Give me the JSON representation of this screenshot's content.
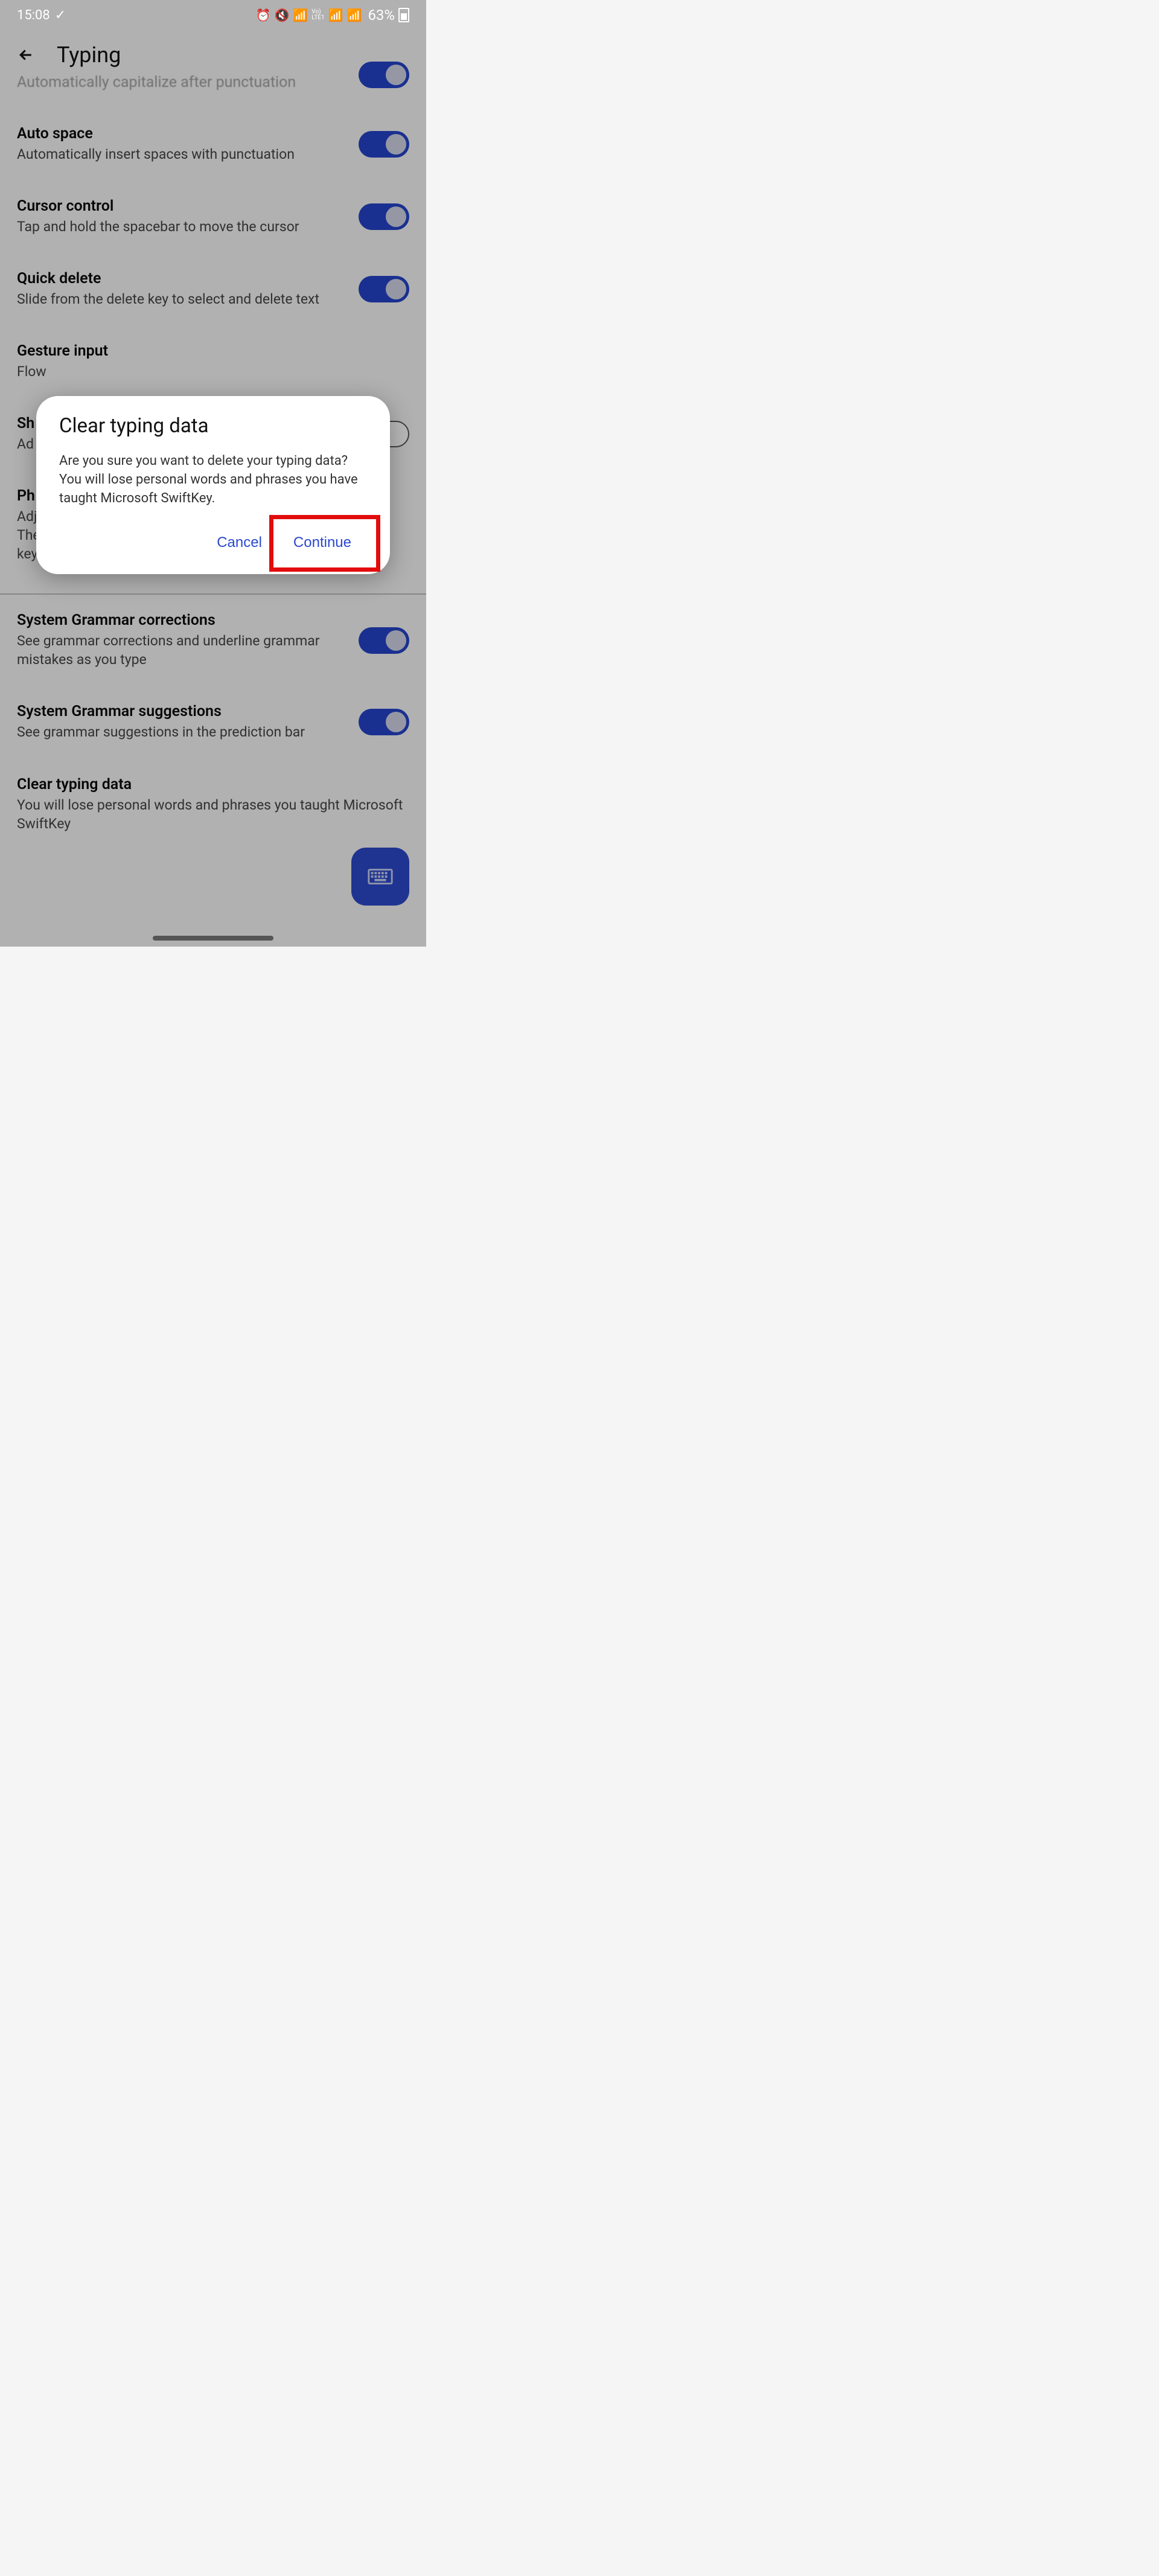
{
  "status": {
    "time": "15:08",
    "battery_pct": "63%"
  },
  "header": {
    "title": "Typing"
  },
  "settings": [
    {
      "title": "",
      "sub_partial": "Automatically capitalize after punctuation",
      "toggle": "on",
      "partial_top": true
    },
    {
      "title": "Auto space",
      "sub": "Automatically insert spaces with punctuation",
      "toggle": "on"
    },
    {
      "title": "Cursor control",
      "sub": "Tap and hold the spacebar to move the cursor",
      "toggle": "on"
    },
    {
      "title": "Quick delete",
      "sub": "Slide from the delete key to select and delete text",
      "toggle": "on"
    },
    {
      "title": "Gesture input",
      "sub": "Flow",
      "toggle": null
    },
    {
      "title_partial": "Sh",
      "sub_partial": "Ad",
      "toggle": "off"
    },
    {
      "title_partial": "Ph",
      "sub_partial_multi": "Adj\nThe\nkey",
      "toggle": null
    },
    {
      "title": "System Grammar corrections",
      "sub": "See grammar corrections and underline grammar mistakes as you type",
      "toggle": "on",
      "after_divider": true
    },
    {
      "title": "System Grammar suggestions",
      "sub": "See grammar suggestions in the prediction bar",
      "toggle": "on"
    },
    {
      "title": "Clear typing data",
      "sub": "You will lose personal words and phrases you taught Microsoft SwiftKey",
      "toggle": null
    }
  ],
  "dialog": {
    "title": "Clear typing data",
    "body": "Are you sure you want to delete your typing data? You will lose personal words and phrases you have taught Microsoft SwiftKey.",
    "cancel": "Cancel",
    "continue": "Continue"
  }
}
